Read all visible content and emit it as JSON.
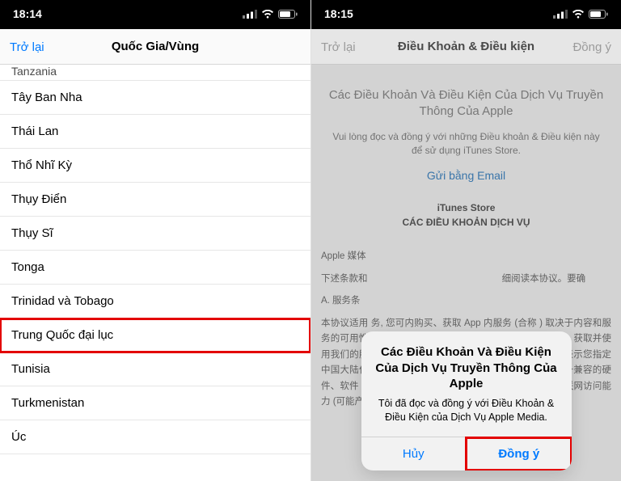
{
  "left": {
    "status": {
      "time": "18:14"
    },
    "nav": {
      "back": "Trở lại",
      "title": "Quốc Gia/Vùng"
    },
    "rows": {
      "partial": "Tanzania",
      "r0": "Tây Ban Nha",
      "r1": "Thái Lan",
      "r2": "Thổ Nhĩ Kỳ",
      "r3": "Thụy Điển",
      "r4": "Thụy Sĩ",
      "r5": "Tonga",
      "r6": "Trinidad và Tobago",
      "r7": "Trung Quốc đại lục",
      "r8": "Tunisia",
      "r9": "Turkmenistan",
      "r10": "Úc"
    }
  },
  "right": {
    "status": {
      "time": "18:15"
    },
    "nav": {
      "back": "Trở lại",
      "title": "Điều Khoản & Điều kiện",
      "agree": "Đồng ý"
    },
    "tc_header": "Các Điều Khoản Và Điều Kiện Của Dịch Vụ Truyền Thông Của Apple",
    "tc_sub": "Vui lòng đọc và đồng ý với những Điều khoản & Điều kiện này để sử dụng iTunes Store.",
    "email": "Gửi bằng Email",
    "store": "iTunes Store",
    "store_sub": "CÁC ĐIỀU KHOẢN DỊCH VỤ",
    "cn1": "Apple 媒体",
    "cn2a": "下述条款和",
    "cn2b": "细阅读本协议。要确",
    "cn3": "A. 服务条",
    "cn4": "本协议适用       务, 您可内购买、获取        App 内服务  (合称                         ) 取决于内容和服务的可用性。您可以在您所在国家或居住所在地（\"居住国\"）获取并使用我们的服务。您创建一个在中国大陆使用服务的帐户, 即表示您指定中国大陆作为您的居住国。为了使用我们的服务, 您需要具备兼容的硬件、软件 (推荐使用最新版本, 有时必须使用最新版本) 和互联网访问能力 (可能产生费用)。我们服务的性能可能受这些因素",
    "alert": {
      "title": "Các Điều Khoản Và Điều Kiện Của Dịch Vụ Truyền Thông Của Apple",
      "msg": "Tôi đã đọc và đồng ý với Điều Khoản & Điều Kiện của Dịch Vụ Apple Media.",
      "cancel": "Hủy",
      "agree": "Đồng ý"
    }
  }
}
